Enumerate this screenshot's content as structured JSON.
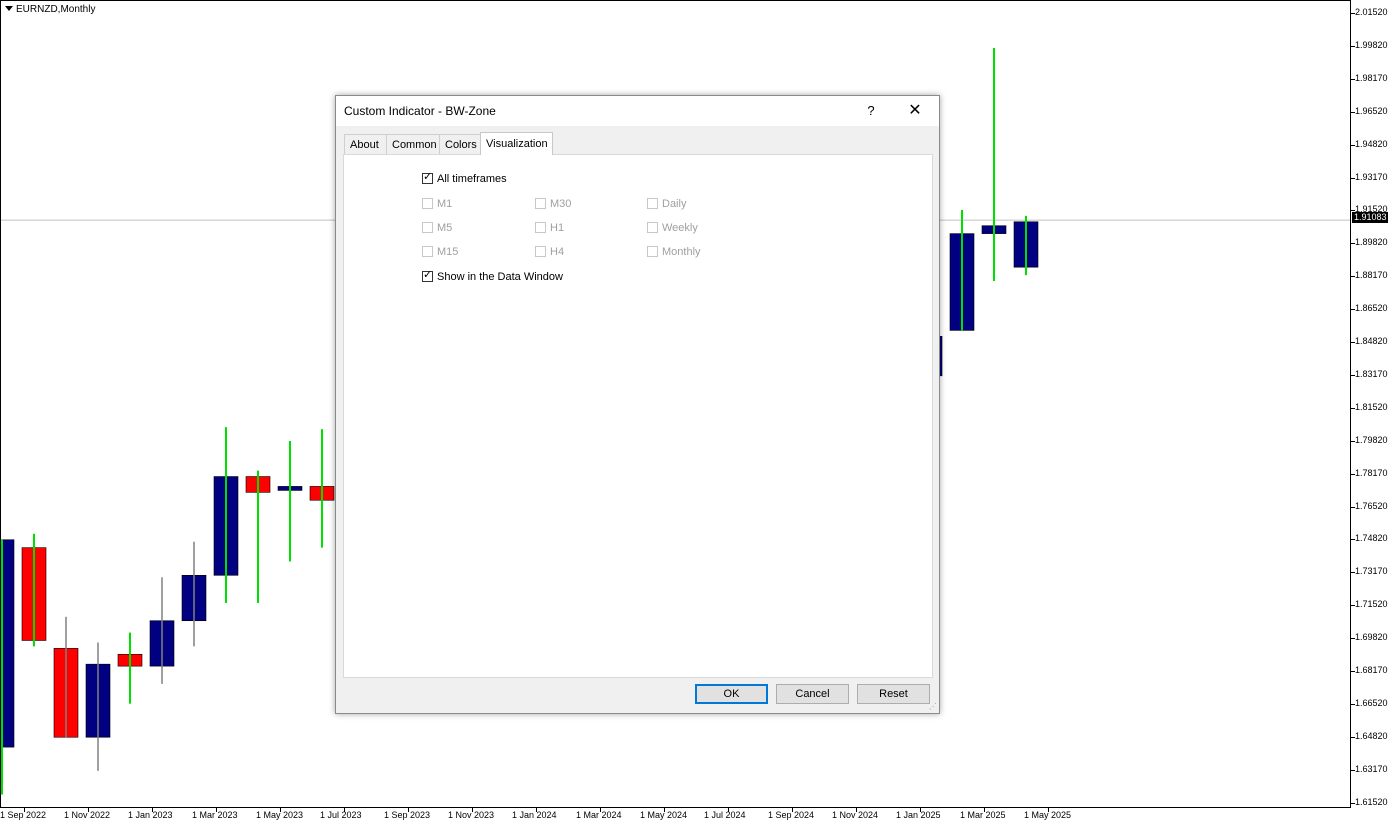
{
  "chart": {
    "symbol_label": "EURNZD,Monthly",
    "current_price": "1.91083",
    "price_axis_labels": [
      "2.01520",
      "1.99820",
      "1.98170",
      "1.96520",
      "1.94820",
      "1.93170",
      "1.91520",
      "1.89820",
      "1.88170",
      "1.86520",
      "1.84820",
      "1.83170",
      "1.81520",
      "1.79820",
      "1.78170",
      "1.76520",
      "1.74820",
      "1.73170",
      "1.71520",
      "1.69820",
      "1.68170",
      "1.66520",
      "1.64820",
      "1.63170",
      "1.61520"
    ],
    "date_axis_labels": [
      "1 Sep 2022",
      "1 Nov 2022",
      "1 Jan 2023",
      "1 Mar 2023",
      "1 May 2023",
      "1 Jul 2023",
      "1 Sep 2023",
      "1 Nov 2023",
      "1 Jan 2024",
      "1 Mar 2024",
      "1 May 2024",
      "1 Jul 2024",
      "1 Sep 2024",
      "1 Nov 2024",
      "1 Jan 2025",
      "1 Mar 2025",
      "1 May 2025"
    ],
    "colors": {
      "bull_body": "#000080",
      "bear_body": "#ff0000",
      "wick_green": "#00e000",
      "wick_gray": "#808080",
      "current_price_line": "#c0c0c0"
    }
  },
  "chart_data": {
    "type": "candlestick",
    "symbol": "EURNZD",
    "timeframe": "Monthly",
    "ylim": [
      1.6152,
      2.0152
    ],
    "candles": [
      {
        "date": "Aug 2022",
        "open": 1.644,
        "close": 1.749,
        "high": 1.749,
        "low": 1.62,
        "color": "bull",
        "wick": "green"
      },
      {
        "date": "Sep 2022",
        "open": 1.745,
        "close": 1.698,
        "high": 1.752,
        "low": 1.695,
        "color": "bear",
        "wick": "green"
      },
      {
        "date": "Oct 2022",
        "open": 1.694,
        "close": 1.649,
        "high": 1.71,
        "low": 1.649,
        "color": "bear",
        "wick": "gray"
      },
      {
        "date": "Nov 2022",
        "open": 1.649,
        "close": 1.686,
        "high": 1.697,
        "low": 1.632,
        "color": "bull",
        "wick": "gray"
      },
      {
        "date": "Dec 2022",
        "open": 1.691,
        "close": 1.685,
        "high": 1.702,
        "low": 1.666,
        "color": "bear",
        "wick": "green"
      },
      {
        "date": "Jan 2023",
        "open": 1.685,
        "close": 1.708,
        "high": 1.73,
        "low": 1.676,
        "color": "bull",
        "wick": "gray"
      },
      {
        "date": "Feb 2023",
        "open": 1.708,
        "close": 1.731,
        "high": 1.748,
        "low": 1.695,
        "color": "bull",
        "wick": "gray"
      },
      {
        "date": "Mar 2023",
        "open": 1.731,
        "close": 1.781,
        "high": 1.806,
        "low": 1.717,
        "color": "bull",
        "wick": "green"
      },
      {
        "date": "Apr 2023",
        "open": 1.781,
        "close": 1.773,
        "high": 1.784,
        "low": 1.717,
        "color": "bear",
        "wick": "green"
      },
      {
        "date": "May 2023",
        "open": 1.774,
        "close": 1.776,
        "high": 1.799,
        "low": 1.738,
        "color": "bull",
        "wick": "green"
      },
      {
        "date": "Jun 2023",
        "open": 1.776,
        "close": 1.769,
        "high": 1.805,
        "low": 1.745,
        "color": "bear",
        "wick": "green"
      },
      {
        "date": "Jan 2025",
        "open": 1.832,
        "close": 1.852,
        "high": 1.852,
        "low": 1.831,
        "color": "bull",
        "wick": "none"
      },
      {
        "date": "Feb 2025",
        "open": 1.855,
        "close": 1.904,
        "high": 1.916,
        "low": 1.855,
        "color": "bull",
        "wick": "green"
      },
      {
        "date": "Mar 2025",
        "open": 1.904,
        "close": 1.908,
        "high": 1.998,
        "low": 1.88,
        "color": "bull",
        "wick": "green"
      },
      {
        "date": "Apr 2025",
        "open": 1.887,
        "close": 1.91,
        "high": 1.913,
        "low": 1.883,
        "color": "bull",
        "wick": "green"
      }
    ],
    "current_price": 1.91083
  },
  "dialog": {
    "title": "Custom Indicator - BW-Zone",
    "help_label": "?",
    "close_label": "✕",
    "tabs": [
      {
        "label": "About",
        "active": false
      },
      {
        "label": "Common",
        "active": false
      },
      {
        "label": "Colors",
        "active": false
      },
      {
        "label": "Visualization",
        "active": true
      }
    ],
    "all_timeframes": {
      "label": "All timeframes",
      "checked": true
    },
    "timeframes": [
      {
        "label": "M1",
        "checked": false,
        "enabled": false
      },
      {
        "label": "M30",
        "checked": false,
        "enabled": false
      },
      {
        "label": "Daily",
        "checked": false,
        "enabled": false
      },
      {
        "label": "M5",
        "checked": false,
        "enabled": false
      },
      {
        "label": "H1",
        "checked": false,
        "enabled": false
      },
      {
        "label": "Weekly",
        "checked": false,
        "enabled": false
      },
      {
        "label": "M15",
        "checked": false,
        "enabled": false
      },
      {
        "label": "H4",
        "checked": false,
        "enabled": false
      },
      {
        "label": "Monthly",
        "checked": false,
        "enabled": false
      }
    ],
    "show_in_data_window": {
      "label": "Show in the Data Window",
      "checked": true
    },
    "ok_label": "OK",
    "cancel_label": "Cancel",
    "reset_label": "Reset"
  }
}
